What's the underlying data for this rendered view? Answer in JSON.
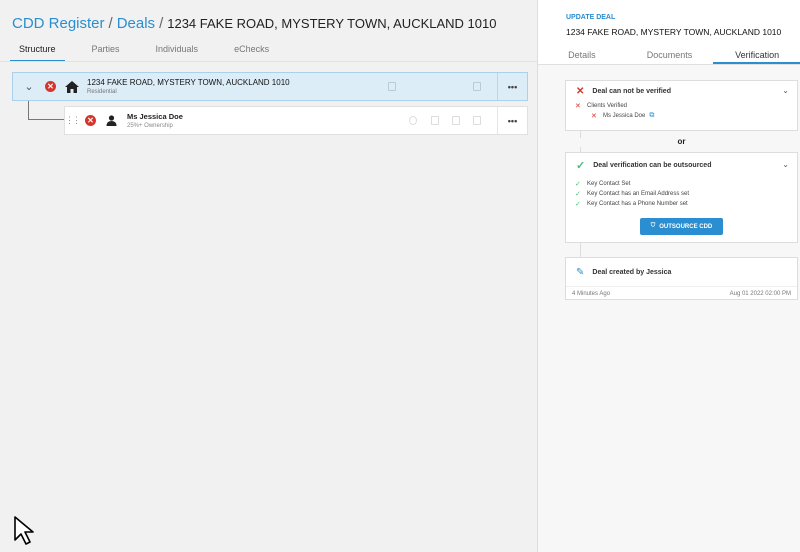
{
  "breadcrumb": {
    "cdd_register": "CDD Register",
    "deals": "Deals",
    "separator": "/",
    "current": "1234 FAKE ROAD, MYSTERY TOWN, AUCKLAND 1010"
  },
  "tabs": [
    "Structure",
    "Parties",
    "Individuals",
    "eChecks"
  ],
  "deal": {
    "title": "1234 FAKE ROAD, MYSTERY TOWN, AUCKLAND 1010",
    "subtitle": "Residential",
    "status_icon": "x-circle-icon",
    "type_icon": "home-icon",
    "menu": "•••"
  },
  "person": {
    "name": "Ms Jessica Doe",
    "subtitle": "25%+ Ownership",
    "status_icon": "x-circle-icon",
    "menu": "•••"
  },
  "panel": {
    "label": "UPDATE DEAL",
    "title": "1234 FAKE ROAD, MYSTERY TOWN, AUCKLAND 1010",
    "tabs": [
      "Details",
      "Documents",
      "Verification"
    ],
    "active_tab": "Verification"
  },
  "not_verified": {
    "title": "Deal can not be verified",
    "items": [
      "Clients Verified"
    ],
    "sub_items": [
      "Ms Jessica Doe"
    ]
  },
  "or_text": "or",
  "outsource": {
    "title": "Deal verification can be outsourced",
    "items": [
      "Key Contact Set",
      "Key Contact has an Email Address set",
      "Key Contact has a Phone Number set"
    ],
    "button": "OUTSOURCE CDD"
  },
  "log": {
    "title": "Deal created by Jessica",
    "ago": "4 Minutes Ago",
    "date": "Aug 01 2022 02:00 PM"
  },
  "colors": {
    "accent": "#2a8ed0",
    "error": "#d9342b",
    "success": "#4cbc7a",
    "selected_row": "#dcedf8"
  }
}
